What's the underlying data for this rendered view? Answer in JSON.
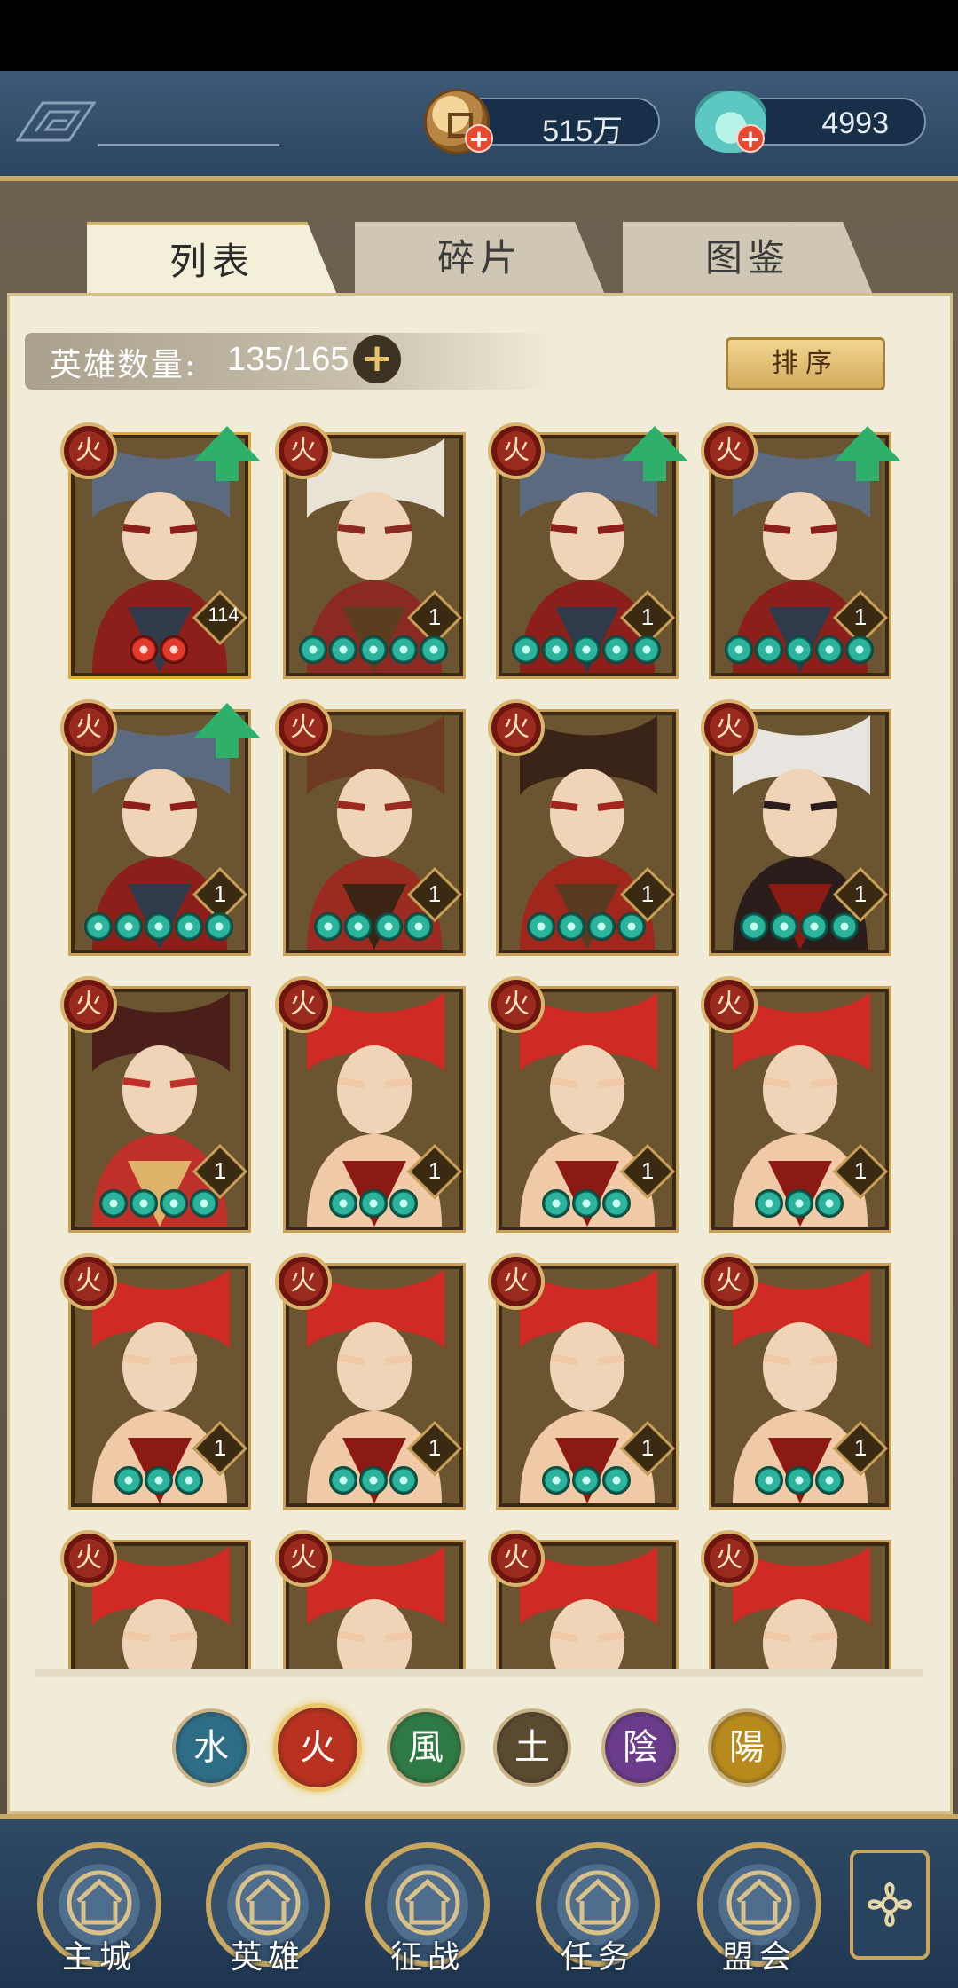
{
  "currency": {
    "coins": "515万",
    "gems": "4993"
  },
  "tabs": [
    "列表",
    "碎片",
    "图鉴"
  ],
  "hero_count": {
    "label": "英雄数量:",
    "value": "135/165"
  },
  "sort_button": "排序",
  "element_badge_glyph": "火",
  "heroes": [
    {
      "level": "114",
      "stars": 2,
      "star_color": "red",
      "upgrade": true,
      "hero": "grey-bearded-warrior"
    },
    {
      "level": "1",
      "stars": 5,
      "star_color": "teal",
      "upgrade": false,
      "hero": "straw-hat-swordswoman"
    },
    {
      "level": "1",
      "stars": 5,
      "star_color": "teal",
      "upgrade": true,
      "hero": "grey-bearded-warrior"
    },
    {
      "level": "1",
      "stars": 5,
      "star_color": "teal",
      "upgrade": true,
      "hero": "grey-bearded-warrior"
    },
    {
      "level": "1",
      "stars": 5,
      "star_color": "teal",
      "upgrade": true,
      "hero": "grey-bearded-warrior"
    },
    {
      "level": "1",
      "stars": 4,
      "star_color": "teal",
      "upgrade": false,
      "hero": "armored-swordsman"
    },
    {
      "level": "1",
      "stars": 4,
      "star_color": "teal",
      "upgrade": false,
      "hero": "masked-ninja"
    },
    {
      "level": "1",
      "stars": 4,
      "star_color": "teal",
      "upgrade": false,
      "hero": "white-haired-warrior"
    },
    {
      "level": "1",
      "stars": 4,
      "star_color": "teal",
      "upgrade": false,
      "hero": "crowned-lady"
    },
    {
      "level": "1",
      "stars": 3,
      "star_color": "teal",
      "upgrade": false,
      "hero": "red-haired-demon"
    },
    {
      "level": "1",
      "stars": 3,
      "star_color": "teal",
      "upgrade": false,
      "hero": "red-haired-demon"
    },
    {
      "level": "1",
      "stars": 3,
      "star_color": "teal",
      "upgrade": false,
      "hero": "red-haired-demon"
    },
    {
      "level": "1",
      "stars": 3,
      "star_color": "teal",
      "upgrade": false,
      "hero": "red-haired-demon"
    },
    {
      "level": "1",
      "stars": 3,
      "star_color": "teal",
      "upgrade": false,
      "hero": "red-haired-demon"
    },
    {
      "level": "1",
      "stars": 3,
      "star_color": "teal",
      "upgrade": false,
      "hero": "red-haired-demon"
    },
    {
      "level": "1",
      "stars": 3,
      "star_color": "teal",
      "upgrade": false,
      "hero": "red-haired-demon"
    },
    {
      "level": "",
      "stars": 0,
      "star_color": "teal",
      "upgrade": false,
      "hero": "red-haired-demon"
    },
    {
      "level": "",
      "stars": 0,
      "star_color": "teal",
      "upgrade": false,
      "hero": "red-haired-demon"
    },
    {
      "level": "",
      "stars": 0,
      "star_color": "teal",
      "upgrade": false,
      "hero": "red-haired-demon"
    },
    {
      "level": "",
      "stars": 0,
      "star_color": "teal",
      "upgrade": false,
      "hero": "red-haired-demon"
    }
  ],
  "element_filters": [
    {
      "glyph": "水",
      "color": "#2e6d86",
      "active": false
    },
    {
      "glyph": "火",
      "color": "#b8321f",
      "active": true
    },
    {
      "glyph": "風",
      "color": "#2f7a44",
      "active": false
    },
    {
      "glyph": "土",
      "color": "#5a4a30",
      "active": false
    },
    {
      "glyph": "陰",
      "color": "#6a3c8a",
      "active": false
    },
    {
      "glyph": "陽",
      "color": "#b88a1c",
      "active": false
    }
  ],
  "bottom_nav": [
    {
      "label": "主城",
      "icon": "city-gate-icon"
    },
    {
      "label": "英雄",
      "icon": "hero-portrait-icon"
    },
    {
      "label": "征战",
      "icon": "battle-icon"
    },
    {
      "label": "任务",
      "icon": "quest-scroll-icon"
    },
    {
      "label": "盟会",
      "icon": "alliance-gate-icon"
    }
  ],
  "nav_more_icon": "flower-menu-icon"
}
